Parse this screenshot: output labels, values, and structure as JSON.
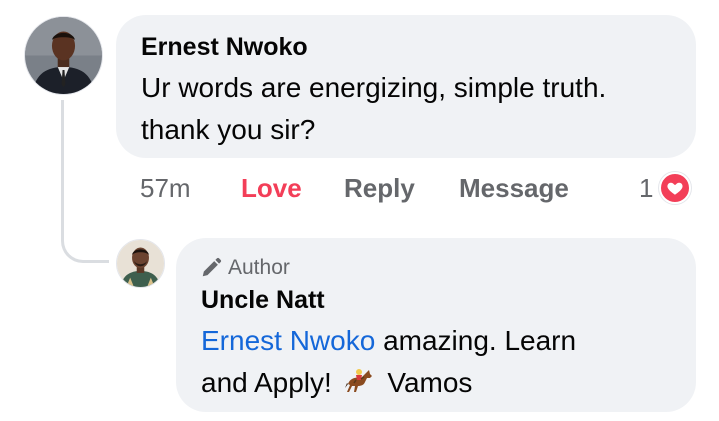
{
  "comment": {
    "author_name": "Ernest Nwoko",
    "text_line1": "Ur words are energizing, simple truth.",
    "text_line2": "thank you sir?",
    "time": "57m",
    "actions": {
      "love": "Love",
      "reply": "Reply",
      "message": "Message"
    },
    "reaction_count": "1",
    "reaction_icon": "heart-icon"
  },
  "reply": {
    "badge": "Author",
    "badge_icon": "pencil-icon",
    "author_name": "Uncle Natt",
    "mention": "Ernest Nwoko",
    "text_part1": " amazing. Learn",
    "text_part2": "and Apply!",
    "emoji_icon": "horse-racing-emoji",
    "text_part3": "Vamos"
  },
  "colors": {
    "bubble_bg": "#f0f2f5",
    "love": "#f33e58",
    "mention": "#1467d9",
    "secondary_text": "#65676b"
  }
}
